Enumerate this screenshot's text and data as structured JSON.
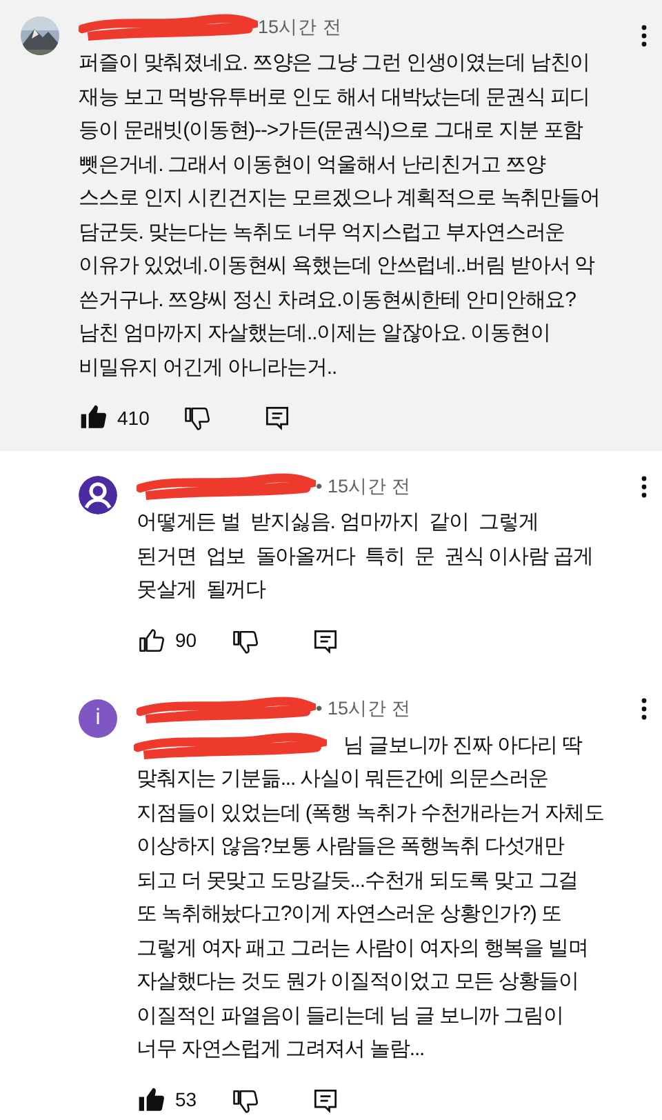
{
  "comments": [
    {
      "kind": "comment",
      "highlighted": true,
      "time": "15시간 전",
      "has_mention": false,
      "text": "퍼즐이 맞춰졌네요. 쯔양은 그냥 그런 인생이였는데 남친이\n재능 보고 먹방유투버로 인도 해서 대박났는데 문권식 피디\n등이 문래빗(이동현)-->가든(문권식)으로 그대로 지분 포함\n뺏은거네. 그래서 이동현이 억울해서 난리친거고 쯔양\n스스로 인지 시킨건지는 모르겠으나 계획적으로 녹취만들어\n담군듯. 맞는다는 녹취도 너무 억지스럽고 부자연스러운\n이유가 있었네.이동현씨 욕했는데 안쓰럽네..버림 받아서 악\n쓴거구나. 쯔양씨 정신 차려요.이동현씨한테 안미안해요?\n남친 엄마까지 자살했는데..이제는 알잖아요. 이동현이\n비밀유지 어긴게 아니라는거..",
      "liked": true,
      "likes": "410"
    },
    {
      "kind": "reply",
      "highlighted": false,
      "avatar": {
        "kind": "default",
        "color": "#4a2ba0"
      },
      "time": "• 15시간 전",
      "has_mention": false,
      "text": "어떻게든 벌  받지싫음. 엄마까지  같이  그렇게\n된거면  업보  돌아올꺼다  특히  문  권식 이사람 곱게\n못살게  될꺼다",
      "liked": false,
      "likes": "90"
    },
    {
      "kind": "reply",
      "highlighted": false,
      "avatar": {
        "kind": "letter",
        "letter": "i",
        "color": "#7e57c2"
      },
      "time": "• 15시간 전",
      "has_mention": true,
      "text": "님 글보니까 진짜 아다리 딱\n맞춰지는 기분듦... 사실이 뭐든간에 의문스러운\n지점들이 있었는데 (폭행 녹취가 수천개라는거 자체도\n이상하지 않음?보통 사람들은 폭행녹취 다섯개만\n되고 더 못맞고 도망갈듯...수천개 되도록 맞고 그걸\n또 녹취해놨다고?이게 자연스러운 상황인가?) 또\n그렇게 여자 패고 그러는 사람이 여자의 행복을 빌며\n자살했다는 것도 뭔가 이질적이었고 모든 상황들이\n이질적인 파열음이 들리는데 님 글 보니까 그림이\n너무 자연스럽게 그려져서 놀람...",
      "liked": true,
      "likes": "53"
    }
  ]
}
